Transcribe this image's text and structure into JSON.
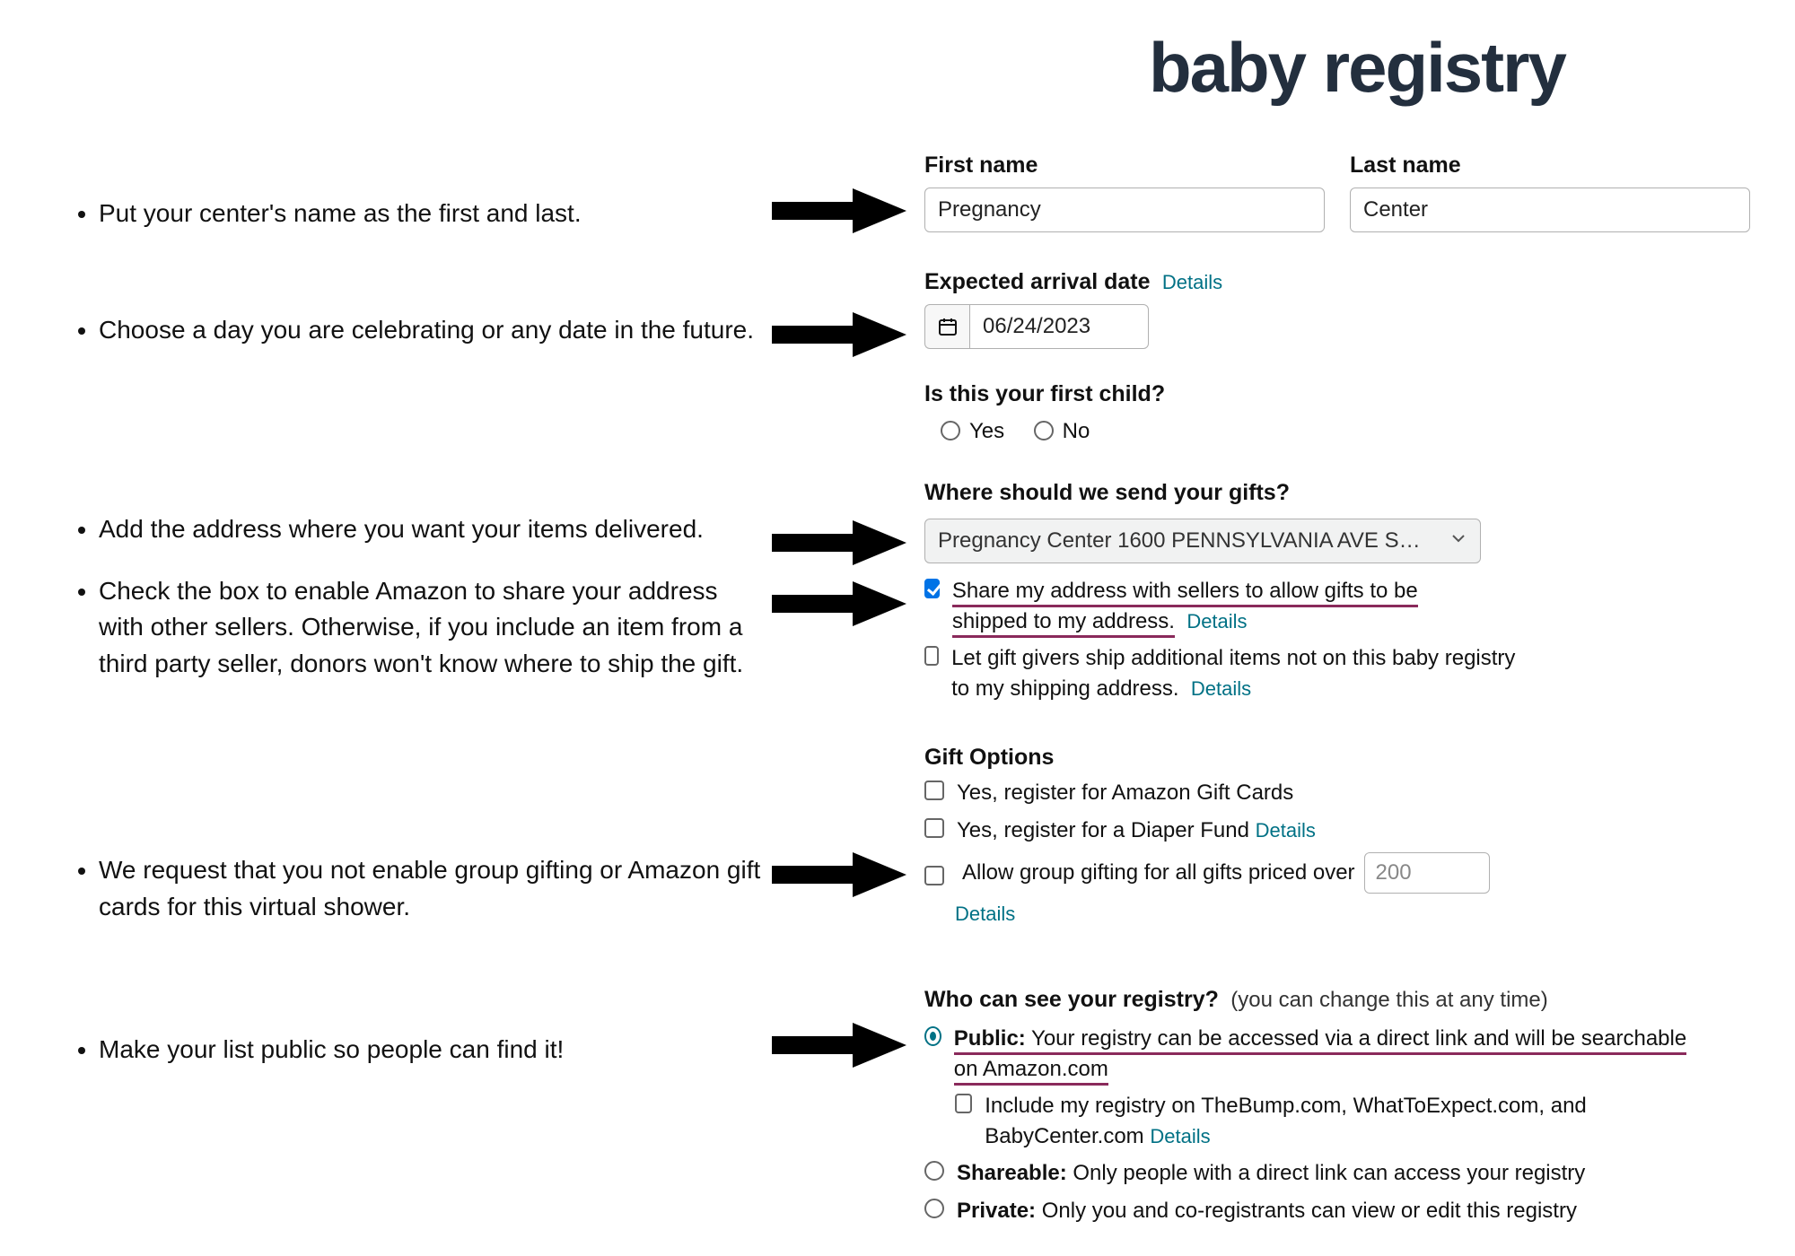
{
  "brand_title": "baby registry",
  "instructions": {
    "name": "Put your center's name as the first and last.",
    "date": "Choose a day you are celebrating or any date in the future.",
    "address": "Add the address where you want your items delivered.",
    "share_box": "Check the box to enable Amazon to share your address with other sellers. Otherwise, if you include an item from a third party seller, donors won't know where to ship the gift.",
    "no_group_gift": "We request that you not enable group gifting or Amazon gift cards for this virtual shower.",
    "public": "Make your list public so people can find it!"
  },
  "form": {
    "first_name_label": "First name",
    "first_name_value": "Pregnancy",
    "last_name_label": "Last name",
    "last_name_value": "Center",
    "expected_label": "Expected arrival date",
    "expected_details_link": "Details",
    "expected_value": "06/24/2023",
    "first_child_label": "Is this your first child?",
    "yes": "Yes",
    "no": "No",
    "gifts_where_label": "Where should we send your gifts?",
    "address_selected": "Pregnancy Center 1600 PENNSYLVANIA AVE S…",
    "share_address_text": "Share my address with sellers to allow gifts to be shipped to my address.",
    "share_address_details": "Details",
    "extra_ship_text": "Let gift givers ship additional items not on this baby registry to my shipping address.",
    "extra_ship_details": "Details",
    "gift_options_label": "Gift Options",
    "gift_cards_text": "Yes, register for Amazon Gift Cards",
    "diaper_fund_text": "Yes, register for a Diaper Fund",
    "diaper_details": "Details",
    "group_gift_text": "Allow group gifting for all gifts priced over",
    "group_gift_value": "200",
    "group_gift_details": "Details",
    "visibility_label": "Who can see your registry?",
    "visibility_hint": "(you can change this at any time)",
    "public_bold": "Public:",
    "public_rest": " Your registry can be accessed via a direct link and will be searchable on Amazon.com",
    "public_include_text": "Include my registry on TheBump.com, WhatToExpect.com, and BabyCenter.com",
    "public_include_details": "Details",
    "shareable_bold": "Shareable:",
    "shareable_rest": " Only people with a direct link can access your registry",
    "private_bold": "Private:",
    "private_rest": " Only you and co-registrants can view or edit this registry"
  }
}
